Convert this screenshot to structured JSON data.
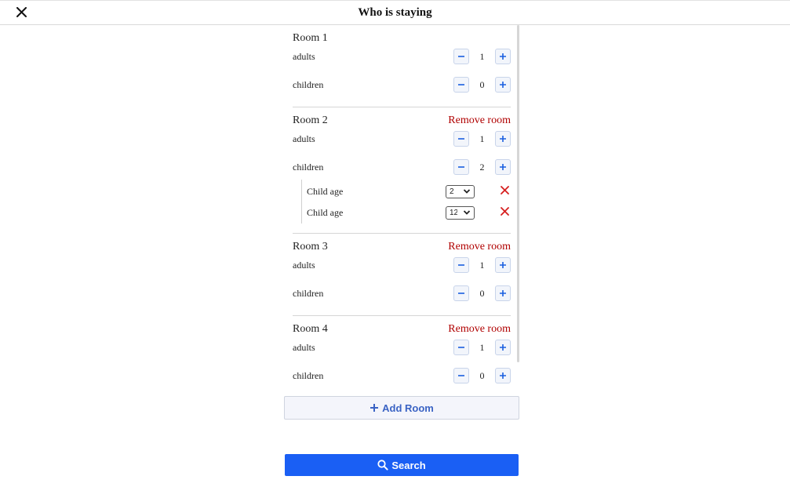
{
  "header": {
    "title": "Who is staying",
    "close_icon": "close-icon"
  },
  "rooms": [
    {
      "title": "Room 1",
      "remove_label": "",
      "adults_label": "adults",
      "adults": "1",
      "children_label": "children",
      "children": "0",
      "child_ages": []
    },
    {
      "title": "Room 2",
      "remove_label": "Remove room",
      "adults_label": "adults",
      "adults": "1",
      "children_label": "children",
      "children": "2",
      "child_ages": [
        {
          "label": "Child age",
          "value": "2"
        },
        {
          "label": "Child age",
          "value": "12"
        }
      ]
    },
    {
      "title": "Room 3",
      "remove_label": "Remove room",
      "adults_label": "adults",
      "adults": "1",
      "children_label": "children",
      "children": "0",
      "child_ages": []
    },
    {
      "title": "Room 4",
      "remove_label": "Remove room",
      "adults_label": "adults",
      "adults": "1",
      "children_label": "children",
      "children": "0",
      "child_ages": []
    }
  ],
  "stepper": {
    "minus_icon": "minus-icon",
    "plus_icon": "plus-icon"
  },
  "actions": {
    "add_room_label": "Add Room",
    "search_label": "Search"
  },
  "colors": {
    "accent": "#1a5ff4",
    "remove": "#b00000",
    "delete_x": "#d61f1f",
    "stepper_icon": "#1a5fe0"
  }
}
